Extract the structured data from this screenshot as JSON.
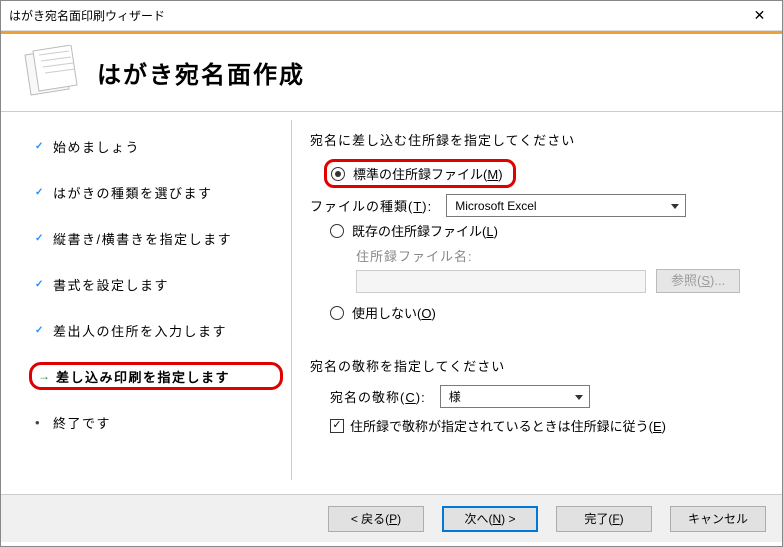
{
  "window": {
    "title": "はがき宛名面印刷ウィザード"
  },
  "header": {
    "title": "はがき宛名面作成"
  },
  "sidebar": {
    "items": [
      {
        "label": "始めましょう",
        "state": "done"
      },
      {
        "label": "はがきの種類を選びます",
        "state": "done"
      },
      {
        "label": "縦書き/横書きを指定します",
        "state": "done"
      },
      {
        "label": "書式を設定します",
        "state": "done"
      },
      {
        "label": "差出人の住所を入力します",
        "state": "done"
      },
      {
        "label": "差し込み印刷を指定します",
        "state": "current"
      },
      {
        "label": "終了です",
        "state": "future"
      }
    ]
  },
  "content": {
    "heading1": "宛名に差し込む住所録を指定してください",
    "radio_standard": {
      "pre": "標準の住所録ファイル(",
      "mn": "M",
      "post": ")"
    },
    "filetype_label": {
      "pre": "ファイルの種類(",
      "mn": "T",
      "post": "):"
    },
    "filetype_value": "Microsoft Excel",
    "radio_existing": {
      "pre": "既存の住所録ファイル(",
      "mn": "L",
      "post": ")"
    },
    "existing_name_label": "住所録ファイル名:",
    "browse": {
      "pre": "参照(",
      "mn": "S",
      "post": ")..."
    },
    "radio_none": {
      "pre": "使用しない(",
      "mn": "O",
      "post": ")"
    },
    "heading2": "宛名の敬称を指定してください",
    "honor_label": {
      "pre": "宛名の敬称(",
      "mn": "C",
      "post": "):"
    },
    "honor_value": "様",
    "chk_label": {
      "pre": "住所録で敬称が指定されているときは住所録に従う(",
      "mn": "E",
      "post": ")"
    }
  },
  "buttons": {
    "back": {
      "pre": "< 戻る(",
      "mn": "P",
      "post": ")"
    },
    "next": {
      "pre": "次へ(",
      "mn": "N",
      "post": ") >"
    },
    "finish": {
      "pre": "完了(",
      "mn": "F",
      "post": ")"
    },
    "cancel": "キャンセル"
  }
}
